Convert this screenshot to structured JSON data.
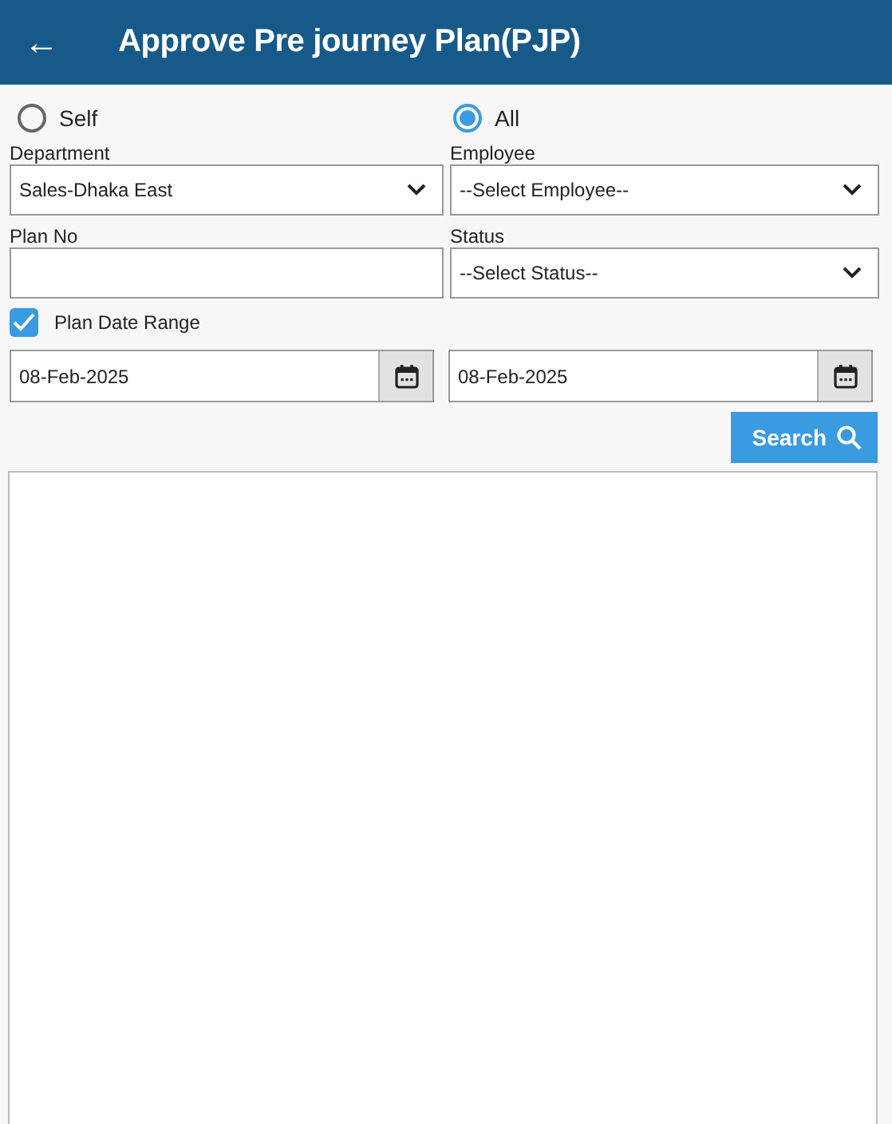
{
  "header": {
    "back": "←",
    "title": "Approve Pre journey Plan(PJP)"
  },
  "scope": [
    {
      "label": "Self",
      "selected": false
    },
    {
      "label": "All",
      "selected": true
    }
  ],
  "department": {
    "label": "Department",
    "value": "Sales-Dhaka East"
  },
  "employee": {
    "label": "Employee",
    "value": "--Select Employee--"
  },
  "plan_no": {
    "label": "Plan No"
  },
  "status": {
    "label": "Status",
    "value": "--Select Status--"
  },
  "date_range": {
    "label": "Plan Date Range",
    "checked": true
  },
  "date_from": {
    "value": "08-Feb-2025"
  },
  "date_to": {
    "value": "08-Feb-2025"
  },
  "search_button": {
    "label": "Search"
  }
}
